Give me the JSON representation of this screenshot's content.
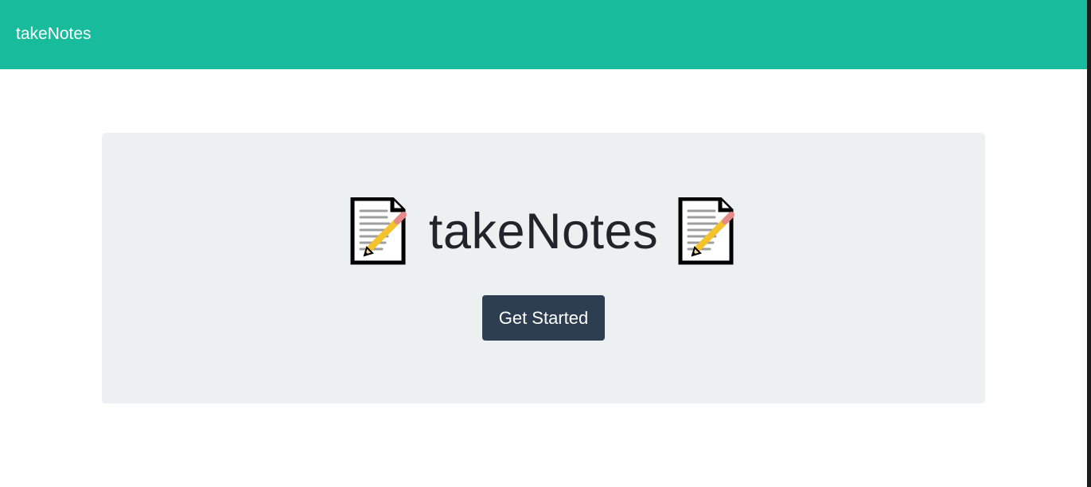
{
  "navbar": {
    "brand": "takeNotes",
    "background_color": "#18bc9c"
  },
  "hero": {
    "title": "takeNotes",
    "leading_icon": "memo-icon",
    "trailing_icon": "memo-icon",
    "panel_color": "#ecf0f1"
  },
  "actions": {
    "get_started_label": "Get Started",
    "button_color": "#2c3e50"
  }
}
